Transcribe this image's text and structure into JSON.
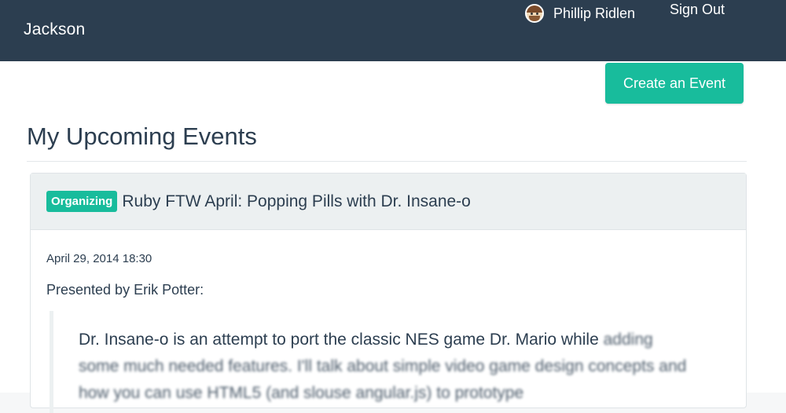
{
  "navbar": {
    "brand": "Jackson",
    "user_name": "Phillip Ridlen",
    "signout_label": "Sign Out"
  },
  "toolbar": {
    "create_label": "Create an Event"
  },
  "page": {
    "title": "My Upcoming Events"
  },
  "event": {
    "badge": "Organizing",
    "title": "Ruby FTW April: Popping Pills with Dr. Insane-o",
    "date": "April 29, 2014 18:30",
    "presenter": "Presented by Erik Potter:",
    "description_clear": "Dr. Insane-o is an attempt to port the classic NES game Dr. Mario while",
    "description_blur": "adding some much needed features. I'll talk about simple video game design concepts and how you can use HTML5 (and slouse angular.js) to prototype"
  },
  "colors": {
    "navbar_bg": "#2c3e50",
    "accent": "#18bc9c",
    "panel_heading_bg": "#ecf0f1"
  }
}
